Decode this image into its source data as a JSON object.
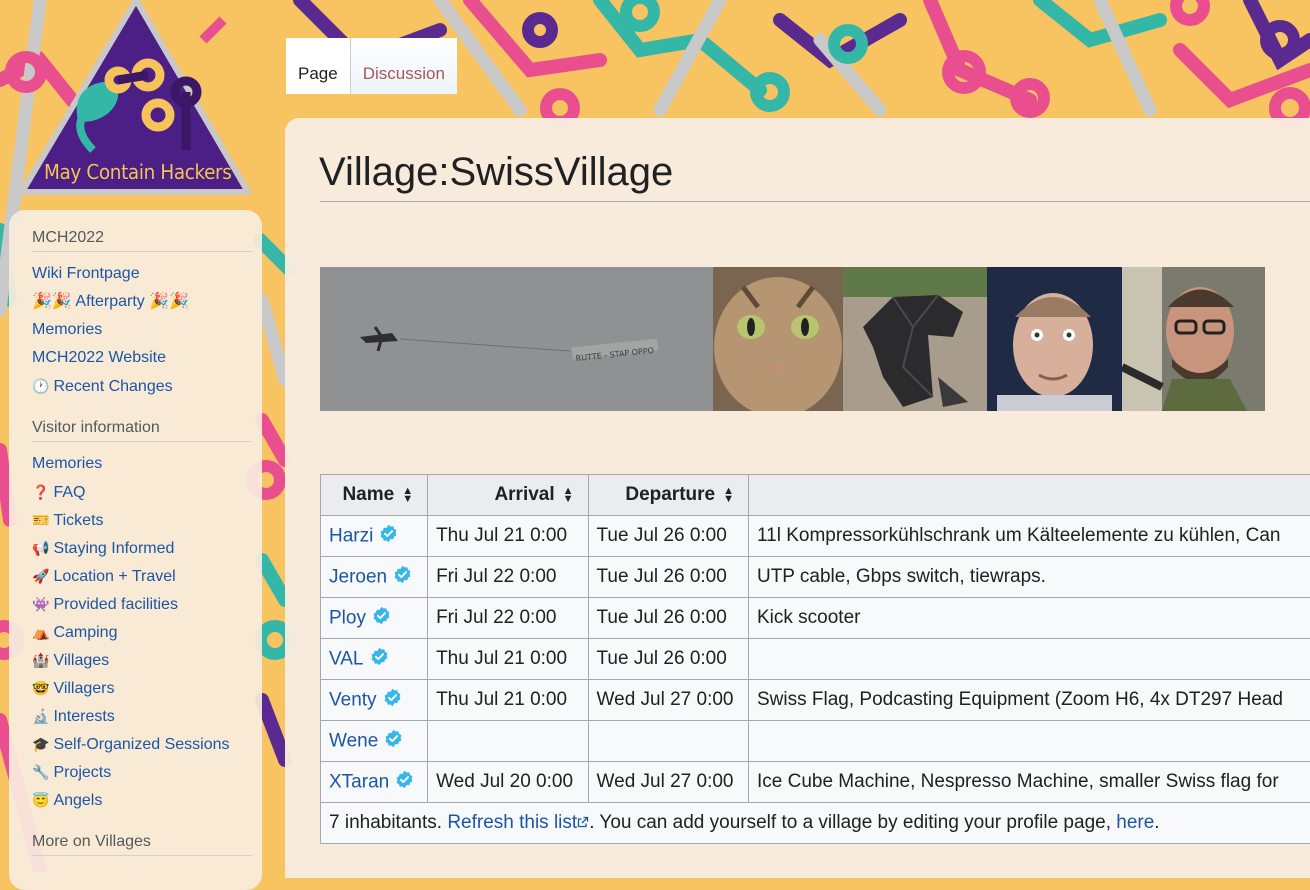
{
  "logo": {
    "text": "May Contain Hackers"
  },
  "tabs": [
    {
      "label": "Page",
      "active": true
    },
    {
      "label": "Discussion",
      "active": false
    }
  ],
  "sidebar": {
    "sections": [
      {
        "heading": "MCH2022",
        "items": [
          {
            "label": "Wiki Frontpage",
            "icon": ""
          },
          {
            "label": "🎉🎉 Afterparty 🎉🎉",
            "icon": ""
          },
          {
            "label": "Memories",
            "icon": ""
          },
          {
            "label": "MCH2022 Website",
            "icon": ""
          },
          {
            "label": "Recent Changes",
            "icon": "🕐"
          }
        ]
      },
      {
        "heading": "Visitor information",
        "items": [
          {
            "label": "Memories",
            "icon": ""
          },
          {
            "label": "FAQ",
            "icon": "❓"
          },
          {
            "label": "Tickets",
            "icon": "🎫"
          },
          {
            "label": "Staying Informed",
            "icon": "📢"
          },
          {
            "label": "Location + Travel",
            "icon": "🚀"
          },
          {
            "label": "Provided facilities",
            "icon": "👾"
          },
          {
            "label": "Camping",
            "icon": "⛺"
          },
          {
            "label": "Villages",
            "icon": "🏰"
          },
          {
            "label": "Villagers",
            "icon": "🤓"
          },
          {
            "label": "Interests",
            "icon": "🔬"
          },
          {
            "label": "Self-Organized Sessions",
            "icon": "🎓"
          },
          {
            "label": "Projects",
            "icon": "🔧"
          },
          {
            "label": "Angels",
            "icon": "😇"
          }
        ]
      },
      {
        "heading": "More on Villages",
        "items": []
      }
    ]
  },
  "page": {
    "title": "Village:SwissVillage"
  },
  "table": {
    "headers": [
      "Name",
      "Arrival",
      "Departure",
      ""
    ],
    "rows": [
      {
        "name": "Harzi",
        "arrival": "Thu Jul 21 0:00",
        "departure": "Tue Jul 26 0:00",
        "brings": "11l Kompressorkühlschrank um Kälteelemente zu kühlen, Can"
      },
      {
        "name": "Jeroen",
        "arrival": "Fri Jul 22 0:00",
        "departure": "Tue Jul 26 0:00",
        "brings": "UTP cable, Gbps switch, tiewraps."
      },
      {
        "name": "Ploy",
        "arrival": "Fri Jul 22 0:00",
        "departure": "Tue Jul 26 0:00",
        "brings": "Kick scooter"
      },
      {
        "name": "VAL",
        "arrival": "Thu Jul 21 0:00",
        "departure": "Tue Jul 26 0:00",
        "brings": ""
      },
      {
        "name": "Venty",
        "arrival": "Thu Jul 21 0:00",
        "departure": "Wed Jul 27 0:00",
        "brings": "Swiss Flag, Podcasting Equipment (Zoom H6, 4x DT297 Head"
      },
      {
        "name": "Wene",
        "arrival": "",
        "departure": "",
        "brings": ""
      },
      {
        "name": "XTaran",
        "arrival": "Wed Jul 20 0:00",
        "departure": "Wed Jul 27 0:00",
        "brings": "Ice Cube Machine, Nespresso Machine, smaller Swiss flag for"
      }
    ],
    "footer": {
      "prefix": "7 inhabitants. ",
      "refresh_link": "Refresh this list",
      "middle": ". You can add yourself to a village by editing your profile page, ",
      "here_link": "here",
      "suffix": "."
    }
  },
  "colors": {
    "link": "#1a56a8",
    "background": "#f8c462",
    "purple": "#5b2a91",
    "pink": "#e94f8e",
    "teal": "#34b7a7"
  }
}
